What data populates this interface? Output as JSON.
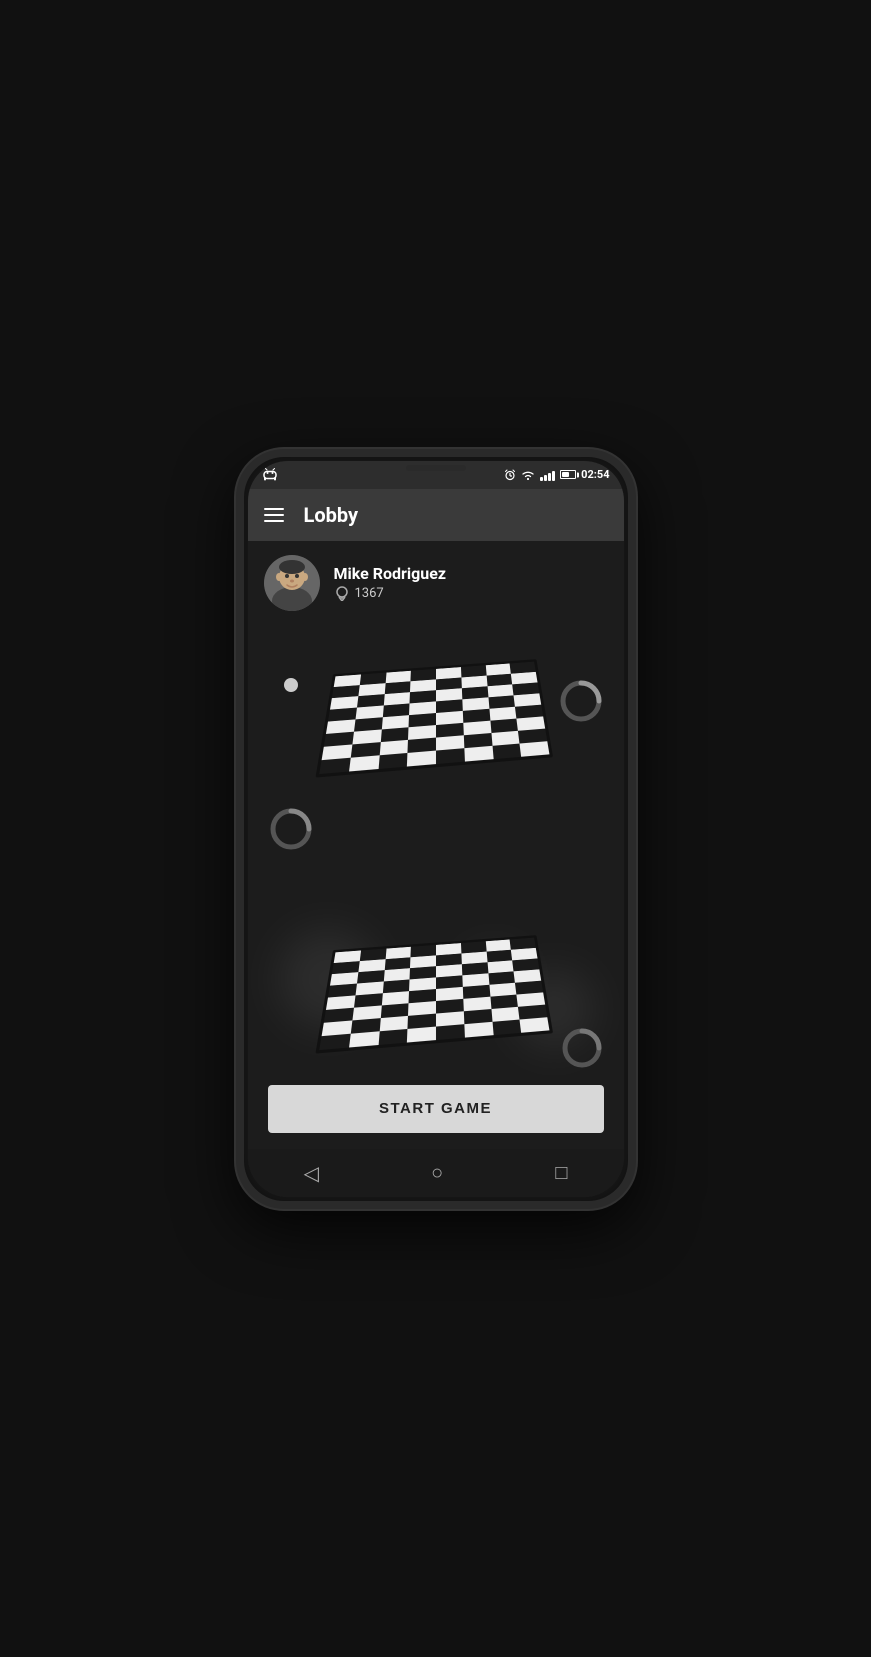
{
  "status_bar": {
    "time": "02:54",
    "icons": [
      "alarm",
      "wifi",
      "signal",
      "battery"
    ]
  },
  "app_bar": {
    "menu_icon": "hamburger",
    "title": "Lobby"
  },
  "user": {
    "name": "Mike Rodriguez",
    "rating": "1367",
    "avatar_alt": "Mike Rodriguez avatar"
  },
  "game": {
    "board_count": 2,
    "start_button_label": "START GAME"
  },
  "nav_bar": {
    "back_icon": "◁",
    "home_icon": "○",
    "recents_icon": "□"
  }
}
